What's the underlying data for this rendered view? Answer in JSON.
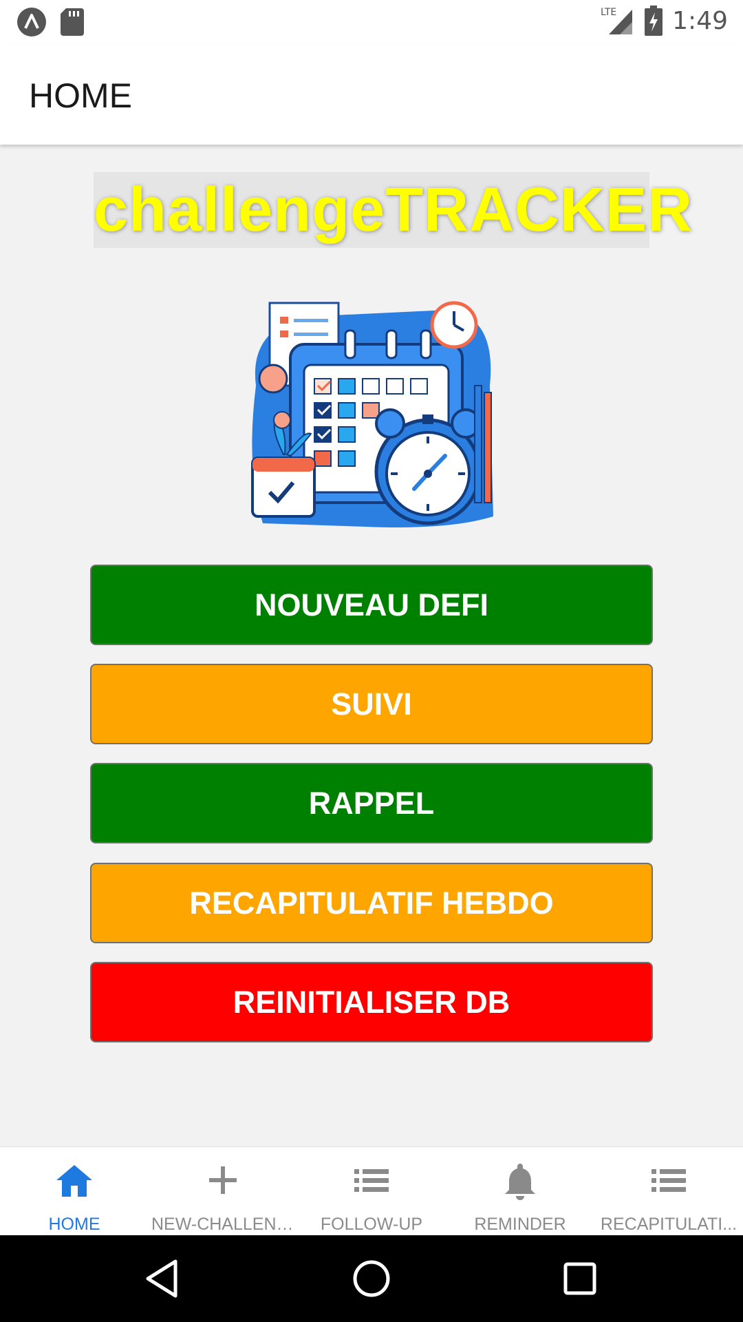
{
  "status_bar": {
    "time": "1:49",
    "network": "LTE"
  },
  "app_bar": {
    "title": "HOME"
  },
  "logo": {
    "text": "challengeTRACKER"
  },
  "buttons": [
    {
      "label": "NOUVEAU DEFI",
      "color": "#008000"
    },
    {
      "label": "SUIVI",
      "color": "#FFA500"
    },
    {
      "label": "RAPPEL",
      "color": "#008000"
    },
    {
      "label": "RECAPITULATIF HEBDO",
      "color": "#FFA500"
    },
    {
      "label": "REINITIALISER DB",
      "color": "#FF0000"
    }
  ],
  "bottom_nav": {
    "items": [
      {
        "label": "HOME",
        "icon": "home-icon",
        "active": true
      },
      {
        "label": "NEW-CHALLENGE",
        "icon": "plus-icon",
        "active": false
      },
      {
        "label": "FOLLOW-UP",
        "icon": "list-icon",
        "active": false
      },
      {
        "label": "REMINDER",
        "icon": "bell-icon",
        "active": false
      },
      {
        "label": "RECAPITULATI...",
        "icon": "list-icon",
        "active": false
      }
    ]
  },
  "colors": {
    "active_tab": "#1f7ae0",
    "inactive_tab": "#8a8a8a",
    "logo_text": "#FFFF00"
  }
}
